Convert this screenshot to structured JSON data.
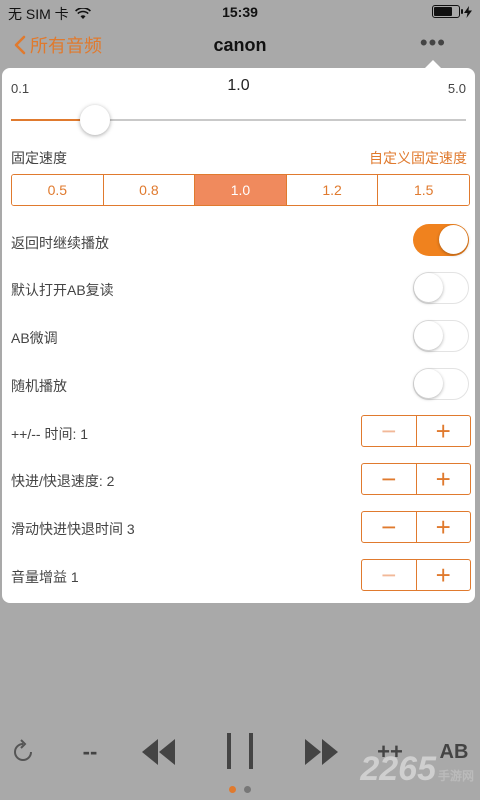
{
  "status_bar": {
    "carrier": "无 SIM 卡",
    "time": "15:39"
  },
  "nav": {
    "back_label": "所有音频",
    "title": "canon",
    "more_icon": "ellipsis-icon"
  },
  "speed_panel": {
    "min_label": "0.1",
    "current_label": "1.0",
    "max_label": "5.0",
    "slider_value": 1.0,
    "slider_min": 0.1,
    "slider_max": 5.0,
    "fixed_speed_label": "固定速度",
    "custom_link": "自定义固定速度",
    "presets": [
      "0.5",
      "0.8",
      "1.0",
      "1.2",
      "1.5"
    ],
    "selected_preset": "1.0"
  },
  "toggles": [
    {
      "label": "返回时继续播放",
      "on": true
    },
    {
      "label": "默认打开AB复读",
      "on": false
    },
    {
      "label": "AB微调",
      "on": false
    },
    {
      "label": "随机播放",
      "on": false
    }
  ],
  "steppers": [
    {
      "label": "++/-- 时间: 1"
    },
    {
      "label": "快进/快退速度: 2"
    },
    {
      "label": "滑动快进快退时间 3"
    },
    {
      "label": "音量增益 1"
    }
  ],
  "controls": {
    "dash_label": "--",
    "plusplus_label": "++",
    "ab_label": "AB"
  },
  "watermark": {
    "text": "2265",
    "sub": "手游网"
  },
  "colors": {
    "accent": "#e07a2e",
    "toggle_on": "#f0821e",
    "segment_active": "#f08a5d",
    "overlay": "#a9a9a9"
  }
}
